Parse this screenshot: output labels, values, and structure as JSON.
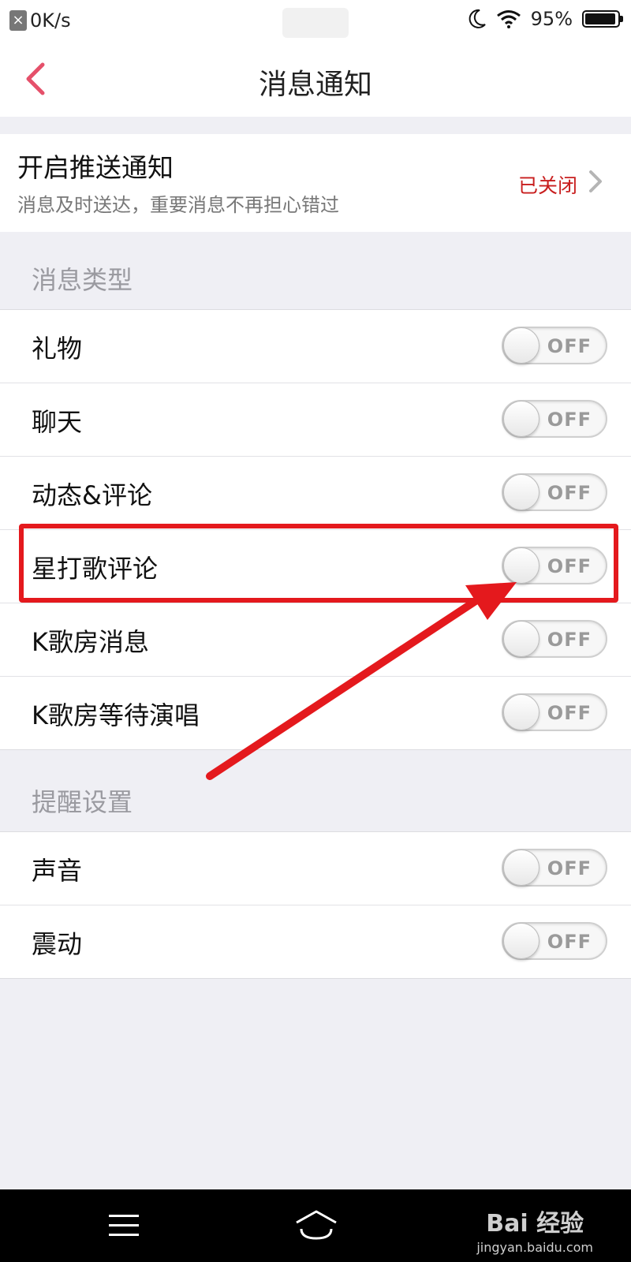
{
  "status_bar": {
    "net_speed": "0K/s",
    "battery": "95%",
    "battery_level": 0.95
  },
  "nav": {
    "title": "消息通知"
  },
  "push": {
    "title": "开启推送通知",
    "subtitle": "消息及时送达，重要消息不再担心错过",
    "status": "已关闭"
  },
  "message_types": {
    "label": "消息类型",
    "items": [
      {
        "label": "礼物",
        "toggle": "OFF"
      },
      {
        "label": "聊天",
        "toggle": "OFF"
      },
      {
        "label": "动态&评论",
        "toggle": "OFF"
      },
      {
        "label": "星打歌评论",
        "toggle": "OFF"
      },
      {
        "label": "K歌房消息",
        "toggle": "OFF"
      },
      {
        "label": "K歌房等待演唱",
        "toggle": "OFF"
      }
    ]
  },
  "reminders": {
    "label": "提醒设置",
    "items": [
      {
        "label": "声音",
        "toggle": "OFF"
      },
      {
        "label": "震动",
        "toggle": "OFF"
      }
    ]
  },
  "watermark": {
    "main": "Bai 经验",
    "sub": "jingyan.baidu.com"
  },
  "colors": {
    "accent_red": "#e4191d",
    "status_red": "#c81e1e",
    "back_arrow": "#e5506a"
  }
}
